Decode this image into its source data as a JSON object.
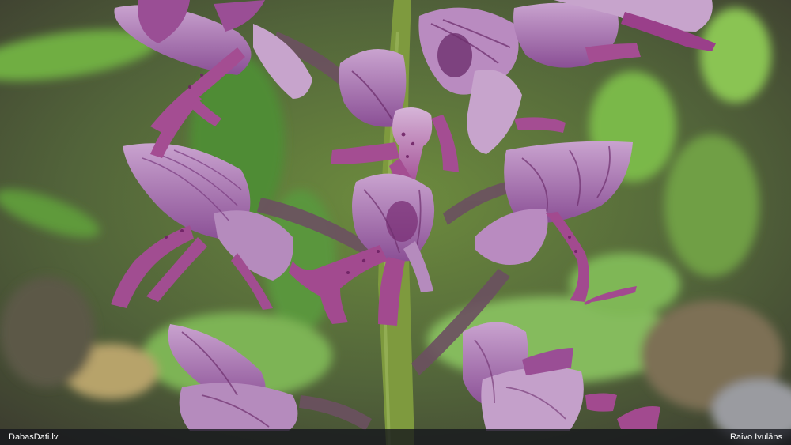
{
  "photo": {
    "subject": "purple-orchid-flower-spike",
    "colors": {
      "petal": "#a877b4",
      "petal_dark": "#6e2f6e",
      "lip": "#b06aa8",
      "stem": "#7a9a3a",
      "leaf": "#7ab04a",
      "background": "#4a5a36"
    }
  },
  "caption": {
    "site": "DabasDati.lv",
    "author": "Raivo Ivulāns"
  }
}
